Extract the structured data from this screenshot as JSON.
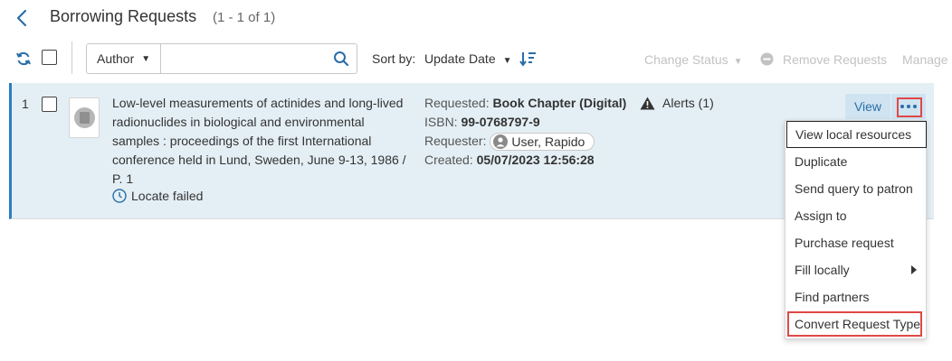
{
  "header": {
    "title": "Borrowing Requests",
    "count": "(1 - 1 of 1)"
  },
  "toolbar": {
    "search_field": "Author",
    "search_placeholder": "",
    "sort_label": "Sort by:",
    "sort_value": "Update Date",
    "change_status": "Change Status",
    "remove_requests": "Remove Requests",
    "manage": "Manage"
  },
  "row": {
    "number": "1",
    "title": "Low-level measurements of actinides and long-lived radionuclides in biological and environmental samples : proceedings of the first International conference held in Lund, Sweden, June 9-13, 1986 / P. 1",
    "locate_status": "Locate failed",
    "requested_label": "Requested:",
    "requested_value": "Book Chapter (Digital)",
    "isbn_label": "ISBN:",
    "isbn_value": "99-0768797-9",
    "requester_label": "Requester:",
    "requester_value": "User, Rapido",
    "created_label": "Created:",
    "created_value": "05/07/2023 12:56:28",
    "alerts": "Alerts (1)",
    "view_label": "View"
  },
  "menu": {
    "items": [
      "View local resources",
      "Duplicate",
      "Send query to patron",
      "Assign to",
      "Purchase request",
      "Fill locally",
      "Find partners",
      "Convert Request Type"
    ]
  },
  "colors": {
    "row_background": "#e4eff5",
    "row_accent": "#2a7fc1",
    "view_button_bg": "#cfe3f1",
    "link_blue": "#2a6ea8",
    "highlight_red": "#e04848",
    "disabled_text": "#c2c2c2"
  },
  "icons": [
    "back-arrow-icon",
    "refresh-icon",
    "search-icon",
    "sort-direction-icon",
    "remove-icon",
    "clock-icon",
    "person-icon",
    "warning-icon",
    "more-options-icon",
    "submenu-arrow-icon"
  ]
}
